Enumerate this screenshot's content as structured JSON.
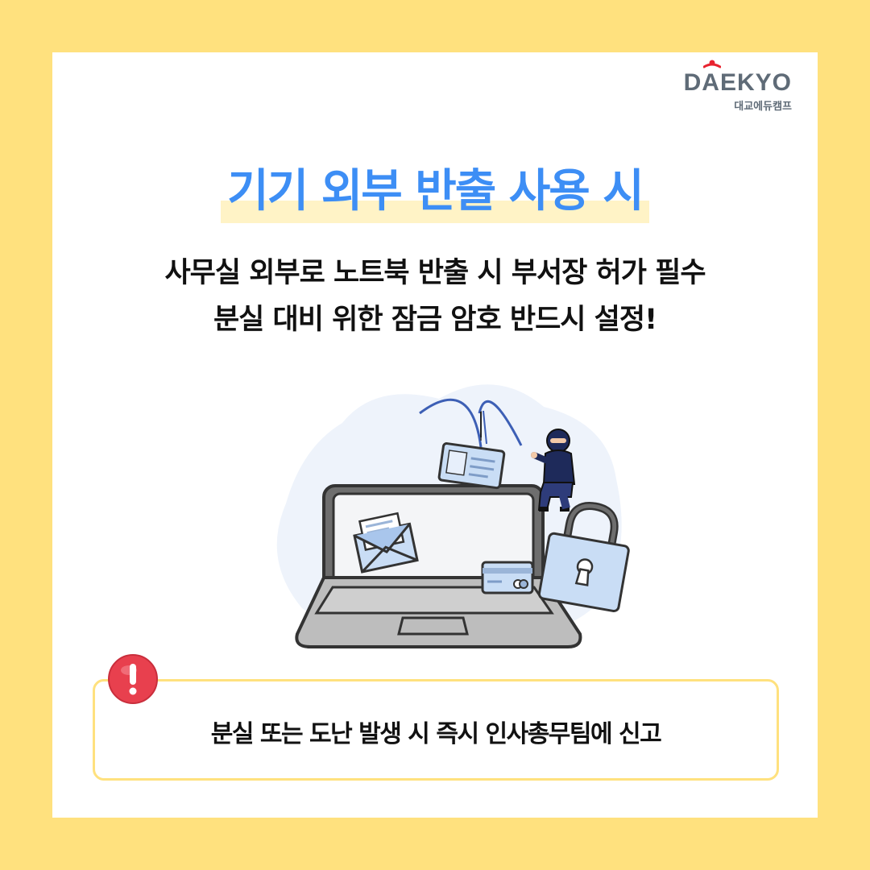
{
  "brand": {
    "logo_text": "DAEKYO",
    "logo_sub": "대교에듀캠프"
  },
  "title": "기기 외부 반출 사용 시",
  "lines": [
    "사무실 외부로 노트북 반출 시 부서장 허가 필수",
    "분실 대비 위한 잠금 암호 반드시 설정!"
  ],
  "notice": {
    "text": "분실 또는 도난 발생 시 즉시 인사총무팀에 신고",
    "icon": "exclamation-icon"
  },
  "colors": {
    "background": "#FFE17E",
    "title": "#3D8EF5",
    "alert": "#E8404E"
  }
}
